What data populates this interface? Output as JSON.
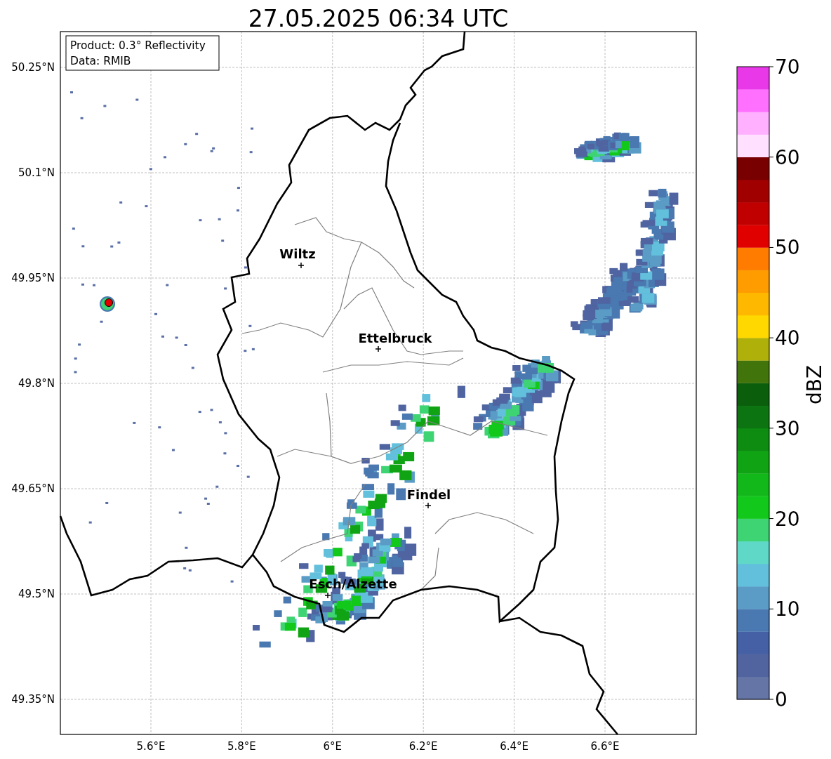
{
  "title": "27.05.2025 06:34 UTC",
  "info_box": {
    "lines": [
      "Product: 0.3° Reflectivity",
      "Data: RMIB"
    ]
  },
  "y_ticks": [
    "50.25°N",
    "50.1°N",
    "49.95°N",
    "49.8°N",
    "49.65°N",
    "49.5°N",
    "49.35°N"
  ],
  "x_ticks": [
    "5.6°E",
    "5.8°E",
    "6°E",
    "6.2°E",
    "6.4°E",
    "6.6°E"
  ],
  "cities": [
    {
      "name": "Wiltz"
    },
    {
      "name": "Ettelbruck"
    },
    {
      "name": "Findel"
    },
    {
      "name": "Esch/Alzette"
    }
  ],
  "colorbar": {
    "label": "dBZ",
    "ticks": [
      "70",
      "60",
      "50",
      "40",
      "30",
      "20",
      "10",
      "0"
    ],
    "levels": [
      {
        "color": "#6475a6"
      },
      {
        "color": "#5264a0"
      },
      {
        "color": "#4560a4"
      },
      {
        "color": "#4a78b0"
      },
      {
        "color": "#5a9cc6"
      },
      {
        "color": "#62c0dc"
      },
      {
        "color": "#60d8c8"
      },
      {
        "color": "#3ed474"
      },
      {
        "color": "#12c81a"
      },
      {
        "color": "#12b81a"
      },
      {
        "color": "#10a414"
      },
      {
        "color": "#0e8c12"
      },
      {
        "color": "#0c7410"
      },
      {
        "color": "#0a5e0c"
      },
      {
        "color": "#42740c"
      },
      {
        "color": "#b0b00a"
      },
      {
        "color": "#ffd800"
      },
      {
        "color": "#ffb800"
      },
      {
        "color": "#ff9c00"
      },
      {
        "color": "#ff7c00"
      },
      {
        "color": "#e00000"
      },
      {
        "color": "#c00000"
      },
      {
        "color": "#a00000"
      },
      {
        "color": "#780000"
      },
      {
        "color": "#ffe0ff"
      },
      {
        "color": "#ffb0ff"
      },
      {
        "color": "#ff70ff"
      },
      {
        "color": "#e838e8"
      }
    ]
  }
}
